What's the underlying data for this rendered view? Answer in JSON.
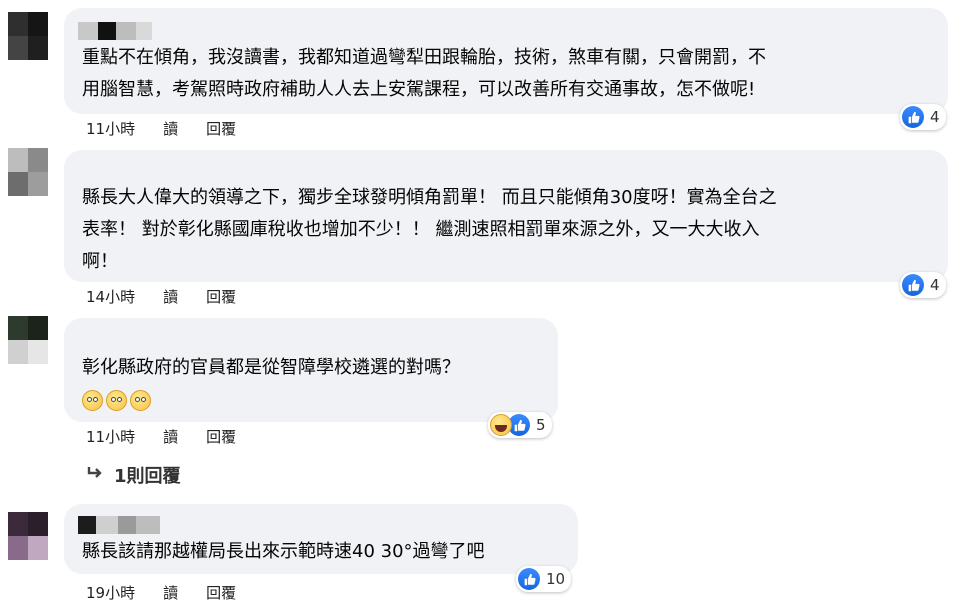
{
  "comments": [
    {
      "lines": [
        "重點不在傾角，我沒讀書，我都知道過彎犁田跟輪胎，技術，煞車有關，只會開罰，不",
        "用腦智慧，考駕照時政府補助人人去上安駕課程，可以改善所有交通事故，怎不做呢!"
      ],
      "time": "11小時",
      "read": "讀",
      "reply": "回覆",
      "likes": "4"
    },
    {
      "lines": [
        "縣長大人偉大的領導之下，獨步全球發明傾角罰單！ 而且只能傾角30度呀！實為全台之",
        "表率！ 對於彰化縣國庫稅收也增加不少！！ 繼測速照相罰單來源之外，又一大大收入",
        "啊！"
      ],
      "time": "14小時",
      "read": "讀",
      "reply": "回覆",
      "likes": "4"
    },
    {
      "lines": [
        "彰化縣政府的官員都是從智障學校遴選的對嗎？"
      ],
      "time": "11小時",
      "read": "讀",
      "reply": "回覆",
      "likes": "5",
      "reply_count_label": "1則回覆"
    },
    {
      "lines": [
        "縣長該請那越權局長出來示範時速40 30°過彎了吧"
      ],
      "time": "19小時",
      "read": "讀",
      "reply": "回覆",
      "likes": "10"
    }
  ],
  "colors": {
    "bubble": "#f0f2f5",
    "like_blue": "#1877f2",
    "meta_text": "#222222"
  },
  "icons": [
    "thumbs-up-icon",
    "haha-icon",
    "eye-roll-emoji",
    "reply-arrow-icon"
  ]
}
